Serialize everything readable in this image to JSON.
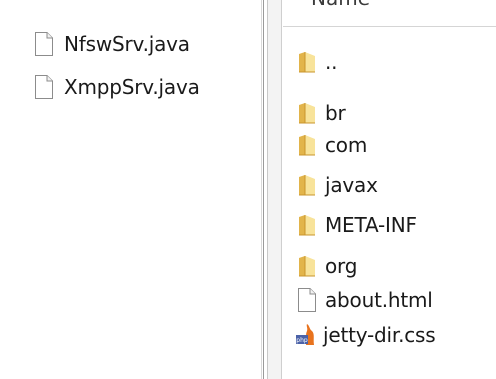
{
  "left_pane": {
    "files": [
      {
        "name": "NfswSrv.java",
        "icon": "file-icon"
      },
      {
        "name": "XmppSrv.java",
        "icon": "file-icon"
      }
    ]
  },
  "right_pane": {
    "column_header": "Name",
    "items": [
      {
        "name": "..",
        "icon": "folder-icon"
      },
      {
        "name": "br",
        "icon": "folder-icon"
      },
      {
        "name": "com",
        "icon": "folder-icon"
      },
      {
        "name": "javax",
        "icon": "folder-icon"
      },
      {
        "name": "META-INF",
        "icon": "folder-icon"
      },
      {
        "name": "org",
        "icon": "folder-icon"
      },
      {
        "name": "about.html",
        "icon": "file-icon"
      },
      {
        "name": "jetty-dir.css",
        "icon": "php-file-icon"
      }
    ]
  },
  "colors": {
    "folder_light": "#f8e39a",
    "folder_dark": "#d9a83a",
    "file_border": "#8c8c8c",
    "php_blue": "#4b62a8",
    "php_orange": "#e8731e"
  }
}
